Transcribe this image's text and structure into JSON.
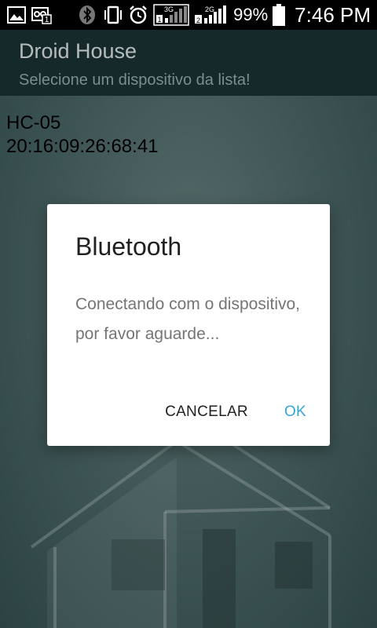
{
  "status_bar": {
    "icons": [
      "image-icon",
      "voicemail-notification-icon",
      "bluetooth-icon",
      "vibrate-icon",
      "alarm-icon",
      "signal-3g-icon",
      "signal-2g-icon"
    ],
    "sim1_label": "1",
    "sim1_network": "3G",
    "sim2_label": "2",
    "sim2_network": "2G",
    "battery": "99%",
    "time": "7:46 PM"
  },
  "action_bar": {
    "title": "Droid House",
    "subtitle": "Selecione um dispositivo da lista!"
  },
  "device_list": [
    {
      "name": "HC-05",
      "address": "20:16:09:26:68:41"
    }
  ],
  "dialog": {
    "title": "Bluetooth",
    "message": "Conectando com o dispositivo, por favor aguarde...",
    "cancel_label": "CANCELAR",
    "ok_label": "OK"
  },
  "colors": {
    "accent": "#33a6d8",
    "action_bar_bg": "#1c3437",
    "status_bar_bg": "#000000"
  }
}
